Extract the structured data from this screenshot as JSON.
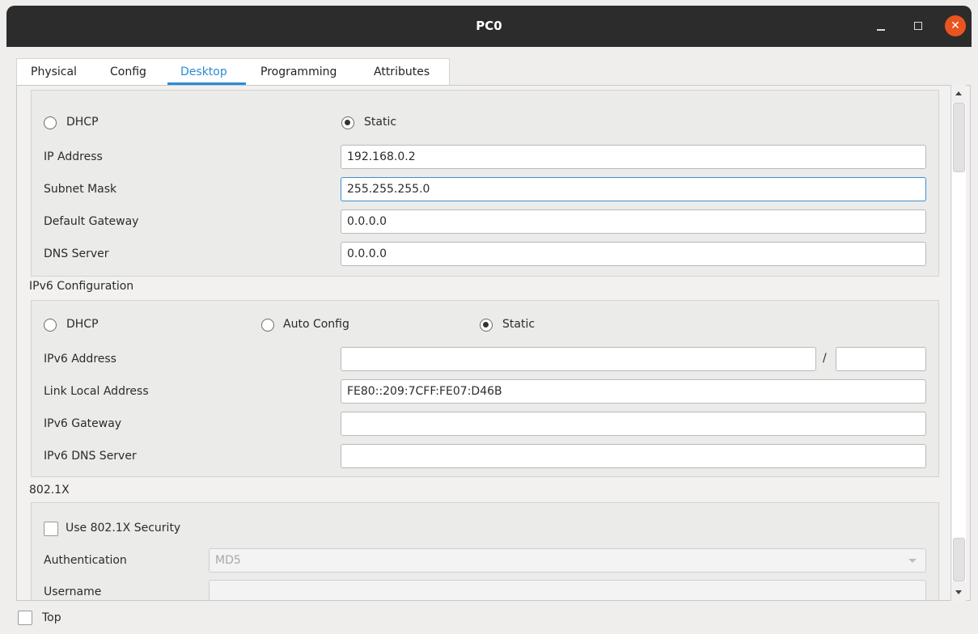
{
  "window": {
    "title": "PC0",
    "controls": {
      "minimize_icon": "minimize-icon",
      "maximize_icon": "maximize-icon",
      "close_icon": "close-icon",
      "close_glyph": "✕"
    }
  },
  "tabs": [
    {
      "label": "Physical",
      "active": false
    },
    {
      "label": "Config",
      "active": false
    },
    {
      "label": "Desktop",
      "active": true
    },
    {
      "label": "Programming",
      "active": false
    },
    {
      "label": "Attributes",
      "active": false
    }
  ],
  "ipv4": {
    "dhcp_label": "DHCP",
    "static_label": "Static",
    "mode": "static",
    "ip_address_label": "IP Address",
    "ip_address_value": "192.168.0.2",
    "subnet_mask_label": "Subnet Mask",
    "subnet_mask_value": "255.255.255.0",
    "default_gateway_label": "Default Gateway",
    "default_gateway_value": "0.0.0.0",
    "dns_server_label": "DNS Server",
    "dns_server_value": "0.0.0.0"
  },
  "ipv6": {
    "section_label": "IPv6 Configuration",
    "dhcp_label": "DHCP",
    "auto_config_label": "Auto Config",
    "static_label": "Static",
    "mode": "static",
    "address_label": "IPv6 Address",
    "address_value": "",
    "prefix_separator": "/",
    "prefix_value": "",
    "link_local_label": "Link Local Address",
    "link_local_value": "FE80::209:7CFF:FE07:D46B",
    "gateway_label": "IPv6 Gateway",
    "gateway_value": "",
    "dns_label": "IPv6 DNS Server",
    "dns_value": ""
  },
  "dot1x": {
    "section_label": "802.1X",
    "use_security_label": "Use 802.1X Security",
    "use_security_checked": false,
    "authentication_label": "Authentication",
    "authentication_value": "MD5",
    "username_label": "Username",
    "username_value": ""
  },
  "footer": {
    "top_label": "Top",
    "top_checked": false
  },
  "colors": {
    "accent": "#2a8bd6",
    "titlebar": "#2c2c2c",
    "close_button": "#e95420"
  }
}
